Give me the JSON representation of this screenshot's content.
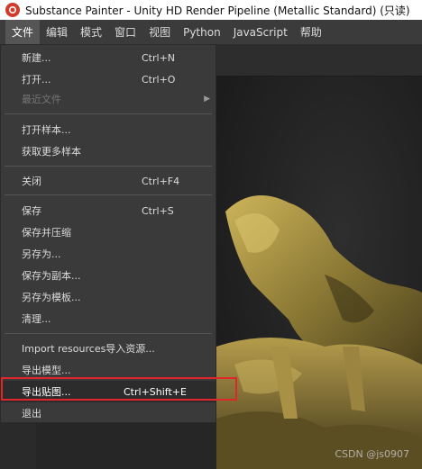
{
  "window": {
    "title": "Substance Painter - Unity HD Render Pipeline (Metallic Standard) (只读)"
  },
  "menubar": {
    "items": [
      "文件",
      "编辑",
      "模式",
      "窗口",
      "视图",
      "Python",
      "JavaScript",
      "帮助"
    ]
  },
  "file_menu": {
    "items": [
      {
        "label": "新建...",
        "shortcut": "Ctrl+N"
      },
      {
        "label": "打开...",
        "shortcut": "Ctrl+O"
      },
      {
        "label": "最近文件",
        "shortcut": ""
      },
      {
        "label": "打开样本...",
        "shortcut": ""
      },
      {
        "label": "获取更多样本",
        "shortcut": ""
      },
      {
        "label": "关闭",
        "shortcut": "Ctrl+F4"
      },
      {
        "label": "保存",
        "shortcut": "Ctrl+S"
      },
      {
        "label": "保存并压缩",
        "shortcut": ""
      },
      {
        "label": "另存为...",
        "shortcut": ""
      },
      {
        "label": "保存为副本...",
        "shortcut": ""
      },
      {
        "label": "另存为模板...",
        "shortcut": ""
      },
      {
        "label": "清理...",
        "shortcut": ""
      },
      {
        "label": "Import resources导入资源...",
        "shortcut": ""
      },
      {
        "label": "导出模型...",
        "shortcut": ""
      },
      {
        "label": "导出贴图...",
        "shortcut": "Ctrl+Shift+E"
      },
      {
        "label": "退出",
        "shortcut": ""
      }
    ]
  },
  "watermark": "CSDN @js0907",
  "colors": {
    "highlight_box": "#e0262a",
    "menu_bg": "#3a3a3a",
    "menubar_bg": "#3b3b3b"
  }
}
